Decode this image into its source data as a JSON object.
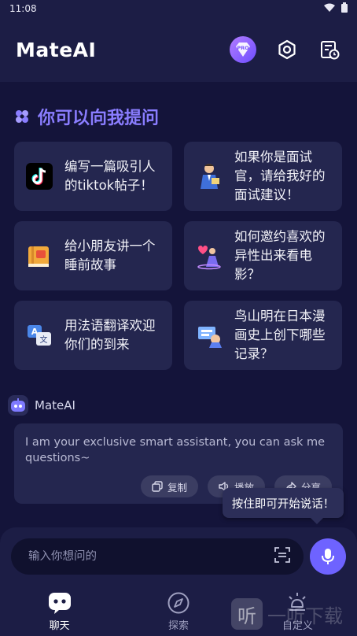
{
  "status_bar": {
    "time": "11:08"
  },
  "header": {
    "title": "MateAI",
    "pro_label": "PRO"
  },
  "section": {
    "title": "你可以向我提问"
  },
  "prompts": [
    {
      "icon": "tiktok-icon",
      "text": "编写一篇吸引人的tiktok帖子！"
    },
    {
      "icon": "interviewer-icon",
      "text": "如果你是面试官，请给我好的面试建议！"
    },
    {
      "icon": "storybook-icon",
      "text": "给小朋友讲一个睡前故事"
    },
    {
      "icon": "date-invite-icon",
      "text": "如何邀约喜欢的异性出来看电影？"
    },
    {
      "icon": "translate-icon",
      "text": "用法语翻译欢迎你们的到来"
    },
    {
      "icon": "manga-icon",
      "text": "鸟山明在日本漫画史上创下哪些记录？"
    }
  ],
  "bot": {
    "name": "MateAI",
    "message": "I am your exclusive smart assistant, you can ask me questions~",
    "actions": {
      "copy": "复制",
      "play": "播放",
      "share": "分享"
    }
  },
  "tooltip": "按住即可开始说话！",
  "input": {
    "placeholder": "输入你想问的",
    "value": ""
  },
  "nav": {
    "chat": "聊天",
    "explore": "探索",
    "custom": "自定义"
  },
  "watermark": {
    "glyph": "听",
    "text": "一听下载"
  },
  "colors": {
    "accent": "#6e63ff",
    "title_accent": "#8a7dff",
    "background": "#14143a",
    "card": "#24264f"
  }
}
